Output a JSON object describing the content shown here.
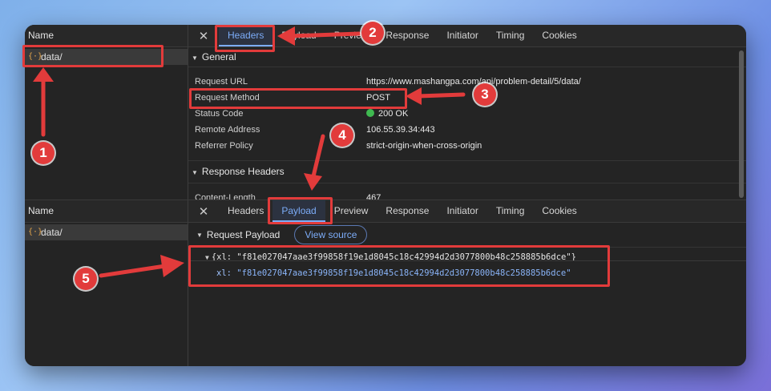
{
  "top": {
    "sidebar_header": "Name",
    "request_name": "data/",
    "tabs": [
      "Headers",
      "Payload",
      "Preview",
      "Response",
      "Initiator",
      "Timing",
      "Cookies"
    ],
    "general_title": "General",
    "general": [
      {
        "key": "Request URL",
        "value": "https://www.mashangpa.com/api/problem-detail/5/data/"
      },
      {
        "key": "Request Method",
        "value": "POST"
      },
      {
        "key": "Status Code",
        "value": "200 OK"
      },
      {
        "key": "Remote Address",
        "value": "106.55.39.34:443"
      },
      {
        "key": "Referrer Policy",
        "value": "strict-origin-when-cross-origin"
      }
    ],
    "response_headers_title": "Response Headers",
    "response_headers": [
      {
        "key": "Content-Length",
        "value": "467"
      }
    ]
  },
  "bottom": {
    "sidebar_header": "Name",
    "request_name": "data/",
    "tabs": [
      "Headers",
      "Payload",
      "Preview",
      "Response",
      "Initiator",
      "Timing",
      "Cookies"
    ],
    "payload_title": "Request Payload",
    "view_source_label": "View source",
    "payload_summary": "{xl: \"f81e027047aae3f99858f19e1d8045c18c42994d2d3077800b48c258885b6dce\"}",
    "payload_key": "xl:",
    "payload_value": "\"f81e027047aae3f99858f19e1d8045c18c42994d2d3077800b48c258885b6dce\""
  },
  "annotations": [
    "1",
    "2",
    "3",
    "4",
    "5"
  ],
  "colors": {
    "annotation": "#e23b3b",
    "accent": "#7cacf8",
    "status_ok": "#3fb950"
  },
  "icons": {
    "request_type": "fetch-icon",
    "close": "close-icon"
  }
}
